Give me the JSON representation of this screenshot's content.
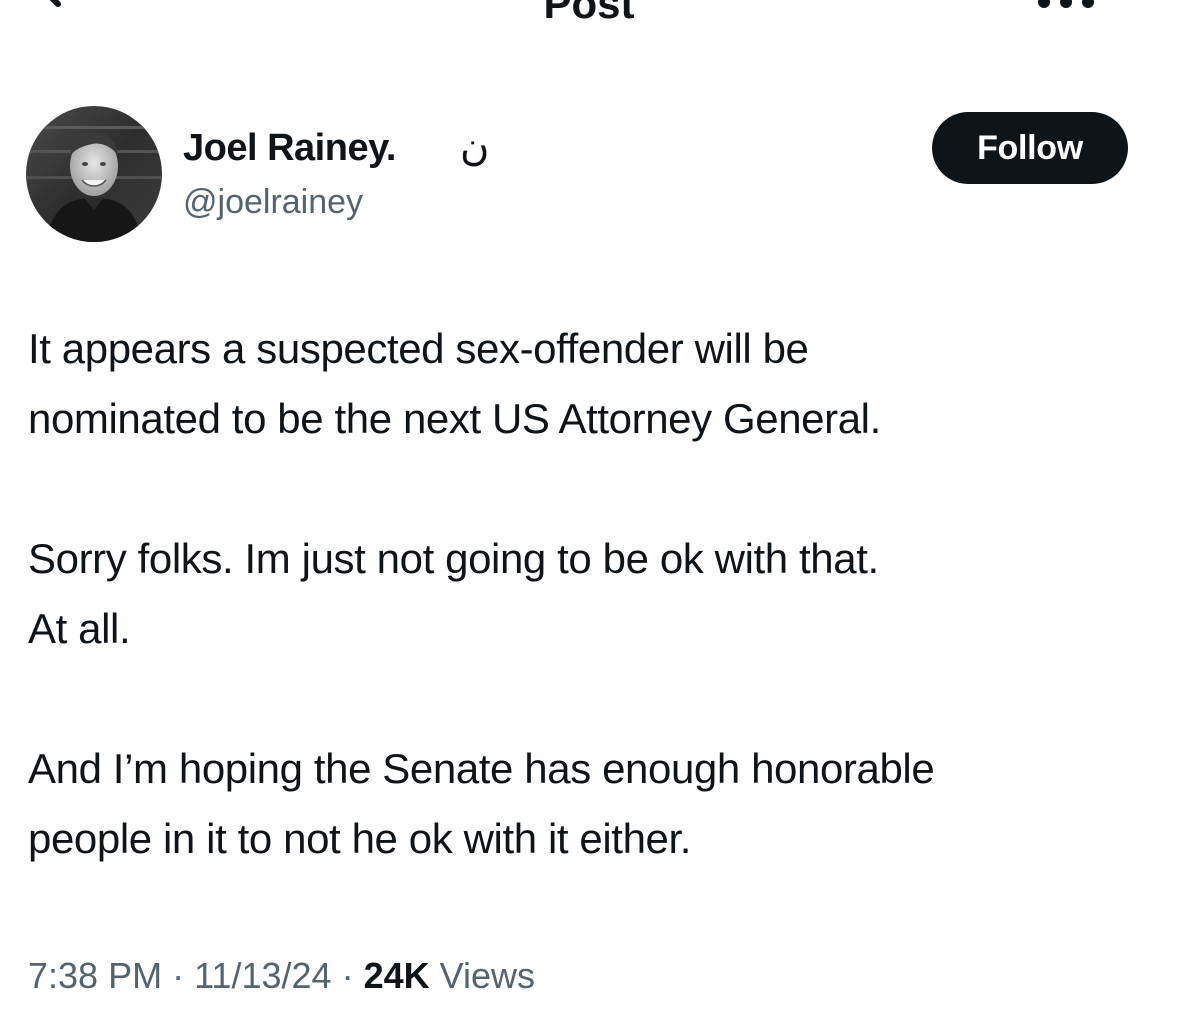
{
  "header": {
    "title": "Post",
    "back_icon": "back-arrow-icon",
    "more_icon": "more-dots-icon"
  },
  "author": {
    "display_name": "Joel Rainey.",
    "name_glyph": "ن",
    "handle": "@joelrainey",
    "avatar_alt": "profile photo"
  },
  "follow_button": {
    "label": "Follow"
  },
  "post": {
    "lines": [
      "It appears a suspected sex-offender will be",
      "nominated to be the next US Attorney General.",
      "Sorry folks. Im just not going to be ok with that.",
      "At all.",
      "And I’m hoping the Senate has enough honorable",
      "people in it to not he ok with it either."
    ]
  },
  "meta": {
    "time": "7:38 PM",
    "separator": "·",
    "date": "11/13/24",
    "views_count": "24K",
    "views_label": "Views"
  },
  "colors": {
    "text": "#0f1419",
    "secondary": "#536471",
    "button_bg": "#0f1419",
    "button_text": "#ffffff"
  }
}
